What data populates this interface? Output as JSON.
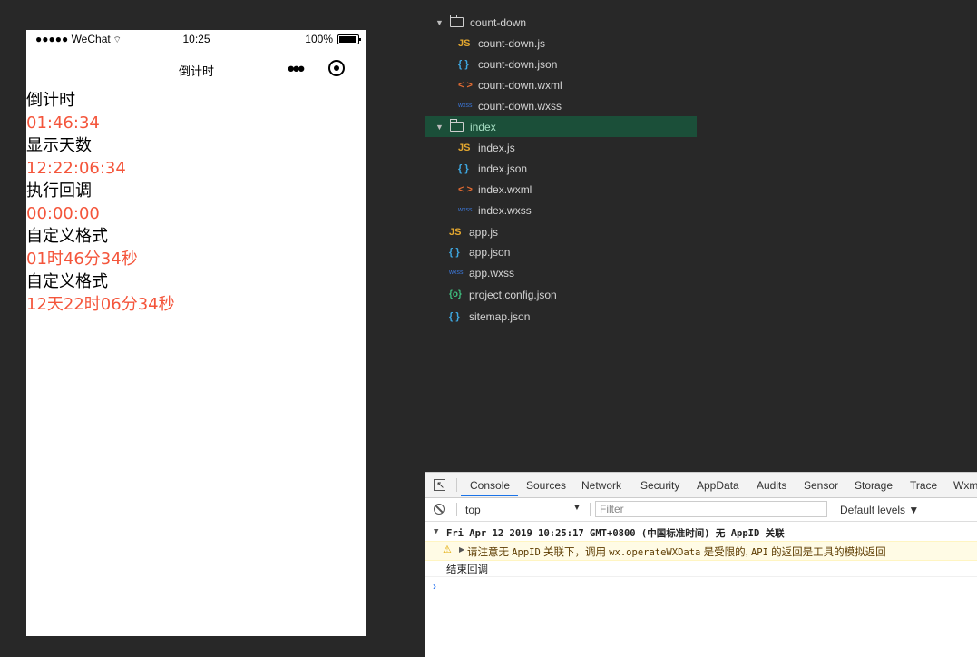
{
  "simulator": {
    "status_carrier": "●●●●● WeChat",
    "status_time": "10:25",
    "status_battery": "100%",
    "nav_title": "倒计时",
    "nav_dots": "•••",
    "items": [
      {
        "label": "倒计时",
        "value": "01:46:34"
      },
      {
        "label": "显示天数",
        "value": "12:22:06:34"
      },
      {
        "label": "执行回调",
        "value": "00:00:00"
      },
      {
        "label": "自定义格式",
        "value": "01时46分34秒"
      },
      {
        "label": "自定义格式",
        "value": "12天22时06分34秒"
      }
    ],
    "value_color": "#f4553b"
  },
  "file_tree": [
    {
      "name": "count-down",
      "type": "folder",
      "indent": 0
    },
    {
      "name": "count-down.js",
      "type": "js",
      "icon": "JS",
      "indent": 1
    },
    {
      "name": "count-down.json",
      "type": "json",
      "icon": "{ }",
      "indent": 1
    },
    {
      "name": "count-down.wxml",
      "type": "wxml",
      "icon": "< >",
      "indent": 1
    },
    {
      "name": "count-down.wxss",
      "type": "wxss",
      "icon": "wxss",
      "indent": 1
    },
    {
      "name": "index",
      "type": "folder",
      "indent": 0,
      "selected": true
    },
    {
      "name": "index.js",
      "type": "js",
      "icon": "JS",
      "indent": 1
    },
    {
      "name": "index.json",
      "type": "json",
      "icon": "{ }",
      "indent": 1
    },
    {
      "name": "index.wxml",
      "type": "wxml",
      "icon": "< >",
      "indent": 1
    },
    {
      "name": "index.wxss",
      "type": "wxss",
      "icon": "wxss",
      "indent": 1
    },
    {
      "name": "app.js",
      "type": "js",
      "icon": "JS",
      "indent": 0
    },
    {
      "name": "app.json",
      "type": "json",
      "icon": "{ }",
      "indent": 0
    },
    {
      "name": "app.wxss",
      "type": "wxss",
      "icon": "wxss",
      "indent": 0
    },
    {
      "name": "project.config.json",
      "type": "cfg",
      "icon": "{o}",
      "indent": 0
    },
    {
      "name": "sitemap.json",
      "type": "json",
      "icon": "{ }",
      "indent": 0
    }
  ],
  "devtools": {
    "tabs": [
      "Console",
      "Sources",
      "Network",
      "Security",
      "AppData",
      "Audits",
      "Sensor",
      "Storage",
      "Trace",
      "Wxm"
    ],
    "active_tab": "Console",
    "context": "top",
    "filter_placeholder": "Filter",
    "levels": "Default levels ▼",
    "log_group": "Fri Apr 12 2019 10:25:17 GMT+0800 (中国标准时间) 无 AppID 关联",
    "warn_a": "请注意无",
    "warn_b": "AppID",
    "warn_c": "关联下，调用",
    "warn_d": "wx.operateWXData",
    "warn_e": "是受限的,",
    "warn_f": "API",
    "warn_g": "的返回是工具的模拟返回",
    "log_plain": "结束回调",
    "prompt": "›"
  }
}
